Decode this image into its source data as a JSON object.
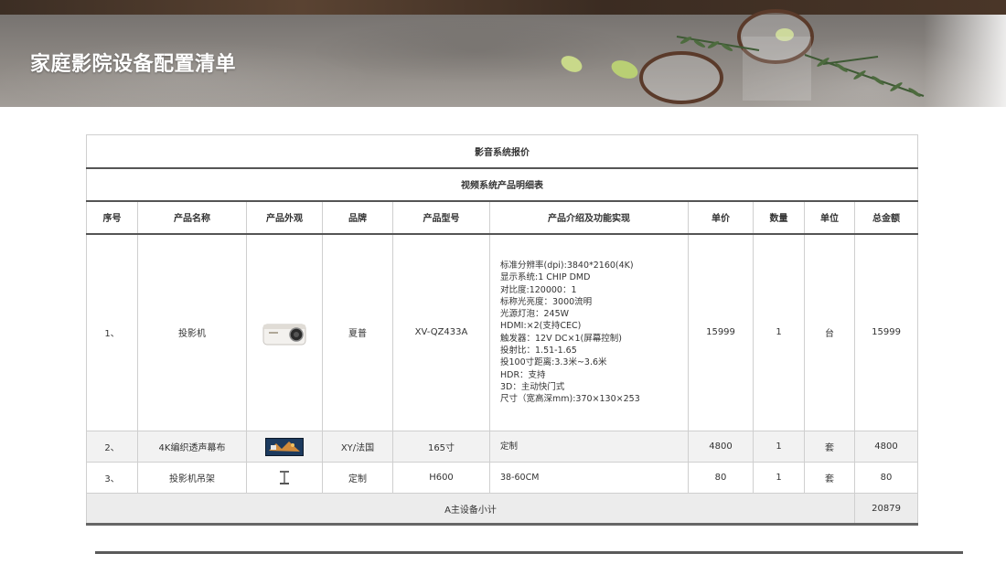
{
  "page_title": "家庭影院设备配置清单",
  "table": {
    "title": "影音系统报价",
    "subtitle": "视频系统产品明细表",
    "headers": [
      "序号",
      "产品名称",
      "产品外观",
      "品牌",
      "产品型号",
      "产品介绍及功能实现",
      "单价",
      "数量",
      "单位",
      "总金额"
    ],
    "rows": [
      {
        "index": "1、",
        "name": "投影机",
        "image": "projector-image",
        "brand": "夏普",
        "model": "XV-QZ433A",
        "desc": [
          "标准分辨率(dpi):3840*2160(4K)",
          "显示系统:1 CHIP DMD",
          "对比度:120000：1",
          "标称光亮度：3000流明",
          "光源灯泡：245W",
          "HDMI:×2(支持CEC)",
          "触发器：12V DC×1(屏幕控制)",
          "投射比：1.51-1.65",
          "投100寸距离:3.3米~3.6米",
          "HDR：支持",
          "3D：主动快门式",
          "尺寸（宽高深mm):370×130×253"
        ],
        "price": "15999",
        "qty": "1",
        "unit": "台",
        "total": "15999"
      },
      {
        "index": "2、",
        "name": "4K编织透声幕布",
        "image": "screen-image",
        "brand": "XY/法国",
        "model": "165寸",
        "desc": [
          "定制"
        ],
        "price": "4800",
        "qty": "1",
        "unit": "套",
        "total": "4800"
      },
      {
        "index": "3、",
        "name": "投影机吊架",
        "image": "mount-image",
        "brand": "定制",
        "model": "H600",
        "desc": [
          "38-60CM"
        ],
        "price": "80",
        "qty": "1",
        "unit": "套",
        "total": "80"
      }
    ],
    "subtotal_label": "A主设备小计",
    "subtotal_value": "20879"
  },
  "colors": {
    "banner_stone": "#8a8580",
    "title_text": "#ffffff",
    "table_border": "#cfcfcf",
    "row_alt": "#f2f2f2",
    "rule": "#5a5a5a"
  }
}
